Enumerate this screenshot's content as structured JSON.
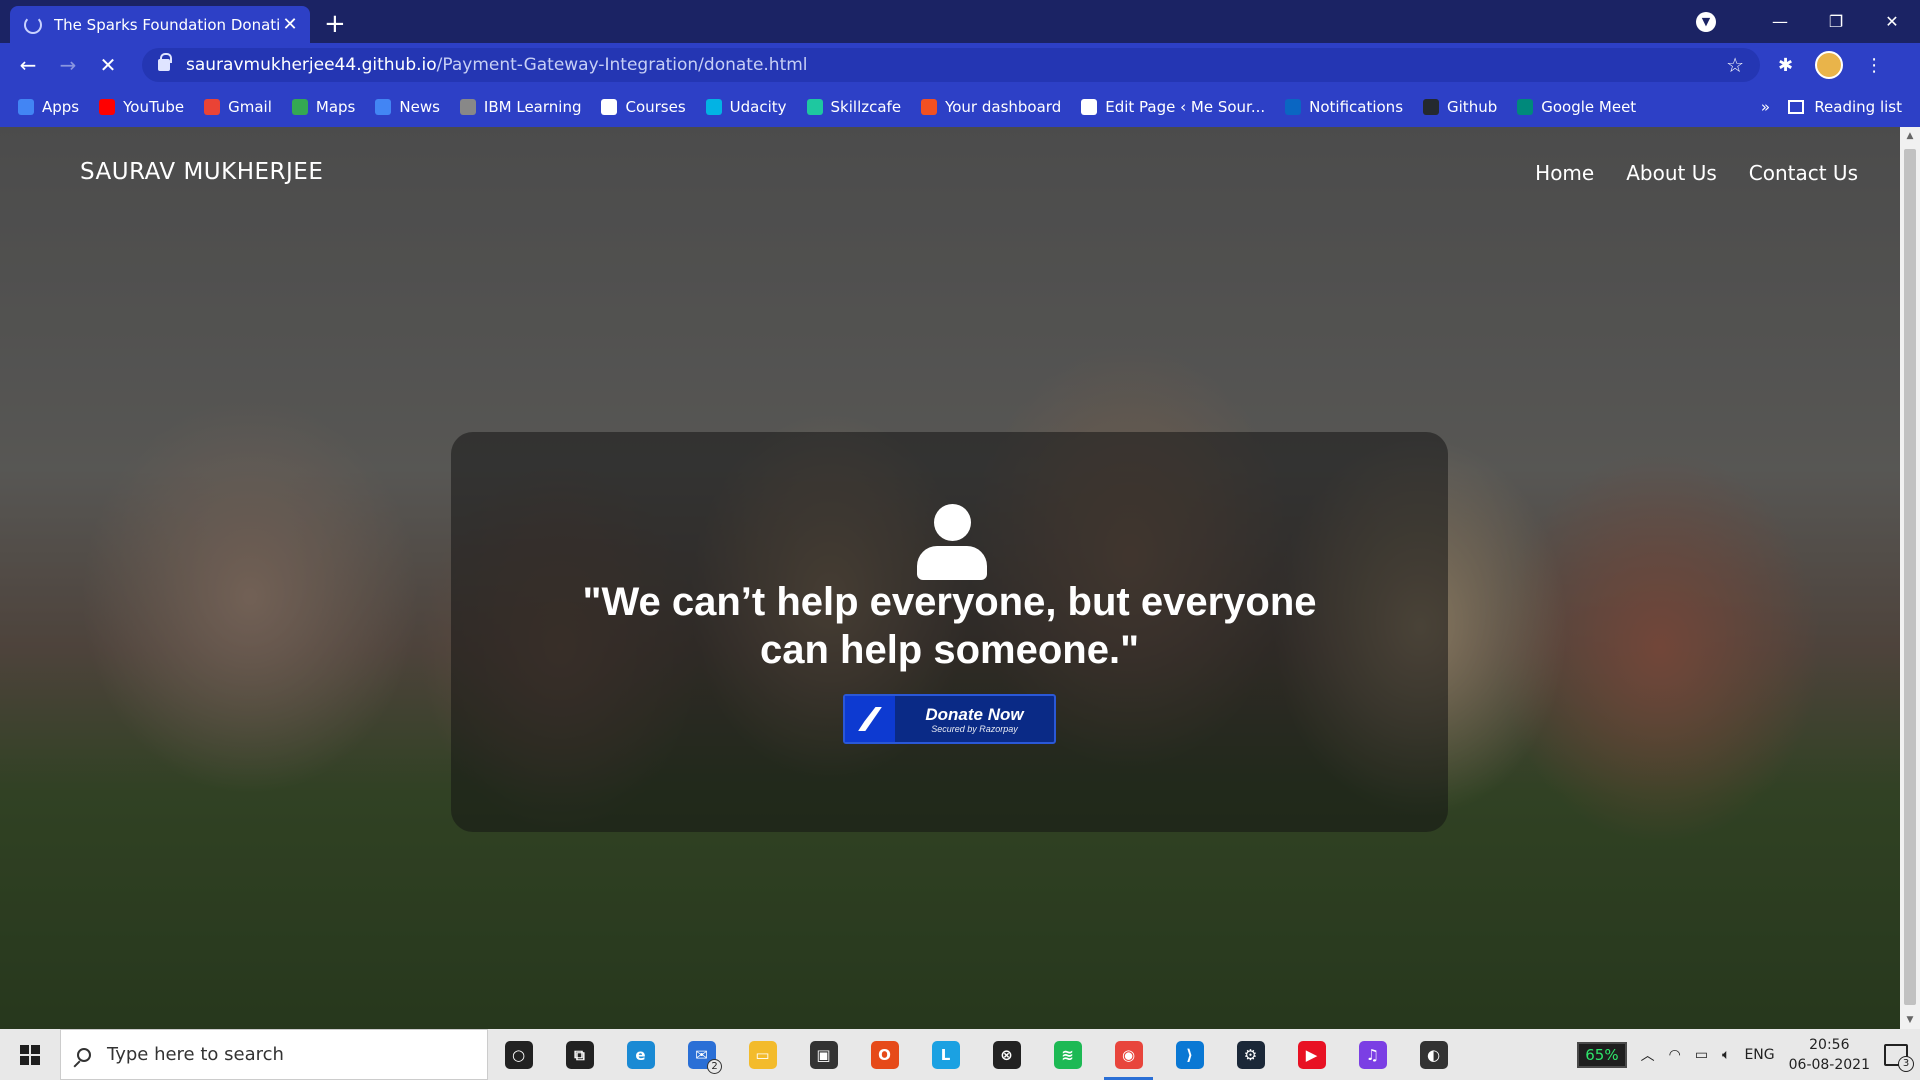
{
  "browser": {
    "tab_title": "The Sparks Foundation Donation",
    "url_host": "sauravmukherjee44.github.io",
    "url_path": "/Payment-Gateway-Integration/donate.html",
    "bookmarks": [
      {
        "label": "Apps",
        "icon": "apps-grid-icon",
        "color": "#4285f4"
      },
      {
        "label": "YouTube",
        "icon": "youtube-icon",
        "color": "#ff0000"
      },
      {
        "label": "Gmail",
        "icon": "gmail-icon",
        "color": "#ea4335"
      },
      {
        "label": "Maps",
        "icon": "maps-icon",
        "color": "#34a853"
      },
      {
        "label": "News",
        "icon": "news-icon",
        "color": "#4285f4"
      },
      {
        "label": "IBM Learning",
        "icon": "ibm-learning-icon",
        "color": "#888888"
      },
      {
        "label": "Courses",
        "icon": "courses-icon",
        "color": "#ffffff"
      },
      {
        "label": "Udacity",
        "icon": "udacity-icon",
        "color": "#02b3e4"
      },
      {
        "label": "Skillzcafe",
        "icon": "skillzcafe-icon",
        "color": "#1ec8a0"
      },
      {
        "label": "Your dashboard",
        "icon": "microsoft-icon",
        "color": "#f25022"
      },
      {
        "label": "Edit Page ‹ Me Sour...",
        "icon": "wordpress-icon",
        "color": "#ffffff"
      },
      {
        "label": "Notifications",
        "icon": "linkedin-icon",
        "color": "#0a66c2"
      },
      {
        "label": "Github",
        "icon": "github-icon",
        "color": "#24292e"
      },
      {
        "label": "Google Meet",
        "icon": "google-meet-icon",
        "color": "#00897b"
      }
    ],
    "more_label": "»",
    "reading_list": "Reading list"
  },
  "site": {
    "brand": "SAURAV MUKHERJEE",
    "nav": [
      "Home",
      "About Us",
      "Contact Us"
    ],
    "quote": "\"We can’t help everyone, but everyone can help someone.\"",
    "donate_label": "Donate Now",
    "donate_sub": "Secured by Razorpay"
  },
  "taskbar": {
    "search_placeholder": "Type here to search",
    "apps": [
      {
        "name": "cortana-icon",
        "color": "#222222",
        "glyph": "○"
      },
      {
        "name": "task-view-icon",
        "color": "#222222",
        "glyph": "⧉"
      },
      {
        "name": "edge-icon",
        "color": "#1a8ad4",
        "glyph": "e"
      },
      {
        "name": "mail-icon",
        "color": "#2a6fd6",
        "glyph": "✉"
      },
      {
        "name": "file-explorer-icon",
        "color": "#f3bb2b",
        "glyph": "▭"
      },
      {
        "name": "store-icon",
        "color": "#333333",
        "glyph": "▣"
      },
      {
        "name": "office-icon",
        "color": "#e64a19",
        "glyph": "O"
      },
      {
        "name": "l-app-icon",
        "color": "#1ba1e2",
        "glyph": "L"
      },
      {
        "name": "xbox-icon",
        "color": "#222222",
        "glyph": "⊗"
      },
      {
        "name": "spotify-icon",
        "color": "#1db954",
        "glyph": "≋"
      },
      {
        "name": "chrome-icon",
        "color": "#e8453c",
        "glyph": "◉"
      },
      {
        "name": "vscode-icon",
        "color": "#0a78d4",
        "glyph": "⟩"
      },
      {
        "name": "steam-icon",
        "color": "#1b2838",
        "glyph": "⚙"
      },
      {
        "name": "media-player-icon",
        "color": "#e81123",
        "glyph": "▶"
      },
      {
        "name": "audio-app-icon",
        "color": "#7b3fe4",
        "glyph": "♫"
      },
      {
        "name": "obs-icon",
        "color": "#333333",
        "glyph": "◐"
      }
    ],
    "mail_badge": "2",
    "battery": "65%",
    "language": "ENG",
    "time": "20:56",
    "date": "06-08-2021",
    "notifications": "3"
  }
}
